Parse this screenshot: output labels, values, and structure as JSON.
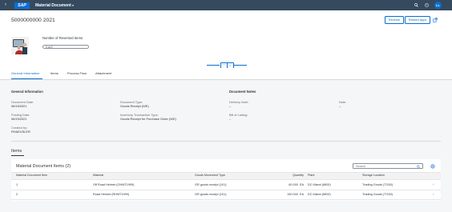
{
  "shell": {
    "app_title": "Material Document",
    "logo_text": "SAP",
    "avatar_initials": "LL",
    "icons": [
      "back-icon",
      "dropdown-icon",
      "search-icon",
      "help-icon"
    ]
  },
  "header": {
    "title": "5000000000 2021",
    "reverse_label": "Reverse",
    "related_apps_label": "Related Apps",
    "kpi_label": "Number of Reversed Items",
    "kpi_value": "0 of 2",
    "kpi_progress": 0
  },
  "tabs": [
    {
      "label": "General Information",
      "selected": true
    },
    {
      "label": "Items",
      "selected": false
    },
    {
      "label": "Process Flow",
      "selected": false
    },
    {
      "label": "Attachment",
      "selected": false
    }
  ],
  "general": {
    "section_title": "General Information",
    "document_date_label": "Document Date:",
    "document_date": "06/15/2021",
    "document_type_label": "Document Type:",
    "document_type": "Goods Receipt (WE)",
    "posting_date_label": "Posting Date:",
    "posting_date": "06/15/2021",
    "inventory_label": "Inventory Transaction Type:",
    "inventory_value": "Goods Receipt for Purchase Order (WE)",
    "created_by_label": "Created by:",
    "created_by": "RHAEUSLER"
  },
  "notes": {
    "section_title": "Document Notes",
    "delivery_note_label": "Delivery Note:",
    "delivery_note": "–",
    "bill_of_lading_label": "Bill of Lading:",
    "bill_of_lading": "–",
    "note_label": "Note:",
    "note": "–"
  },
  "items": {
    "heading": "Items",
    "table_title": "Material Document Items (2)",
    "search_placeholder": "Search",
    "columns": [
      "Material Document Item",
      "Material",
      "Goods Movement Type",
      "Quantity",
      "Plant",
      "Storage Location"
    ],
    "rows": [
      {
        "item": "1",
        "material": "Off Road Helmet (OHMT1999)",
        "movement": "GR goods receipt (101)",
        "quantity": "60.000",
        "unit": "EA",
        "plant": "DC Miami (MI00)",
        "storage": "Trading Goods (TG00)"
      },
      {
        "item": "2",
        "material": "Road Helmet (RHMT1999)",
        "movement": "GR goods receipt (101)",
        "quantity": "150.000",
        "unit": "EA",
        "plant": "DC Miami (MI00)",
        "storage": "Trading Goods (TG00)"
      }
    ]
  }
}
